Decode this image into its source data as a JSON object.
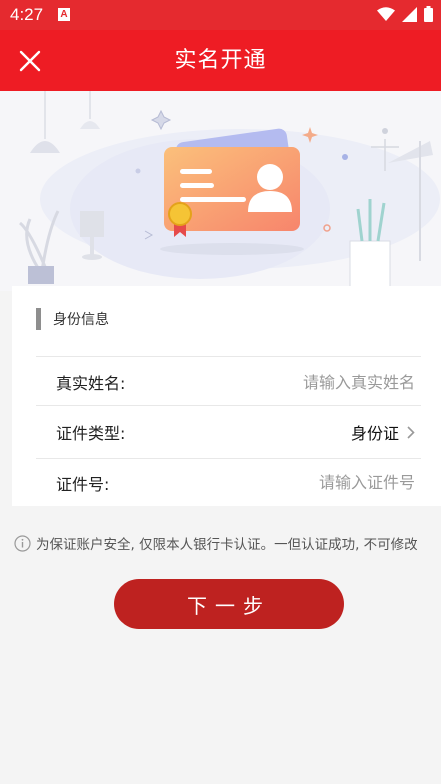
{
  "status_bar": {
    "time": "4:27",
    "app_badge": "A"
  },
  "header": {
    "title": "实名开通"
  },
  "section": {
    "title": "身份信息"
  },
  "form": {
    "name": {
      "label": "真实姓名:",
      "placeholder": "请输入真实姓名",
      "value": ""
    },
    "id_type": {
      "label": "证件类型:",
      "value": "身份证"
    },
    "id_number": {
      "label": "证件号:",
      "placeholder": "请输入证件号",
      "value": ""
    }
  },
  "notice": {
    "text": "为保证账户安全, 仅限本人银行卡认证。一但认证成功, 不可修改"
  },
  "next_button": {
    "label": "下一步"
  },
  "colors": {
    "header": "#ee1c24",
    "status_bar": "#e52a2f",
    "button": "#be2220"
  }
}
